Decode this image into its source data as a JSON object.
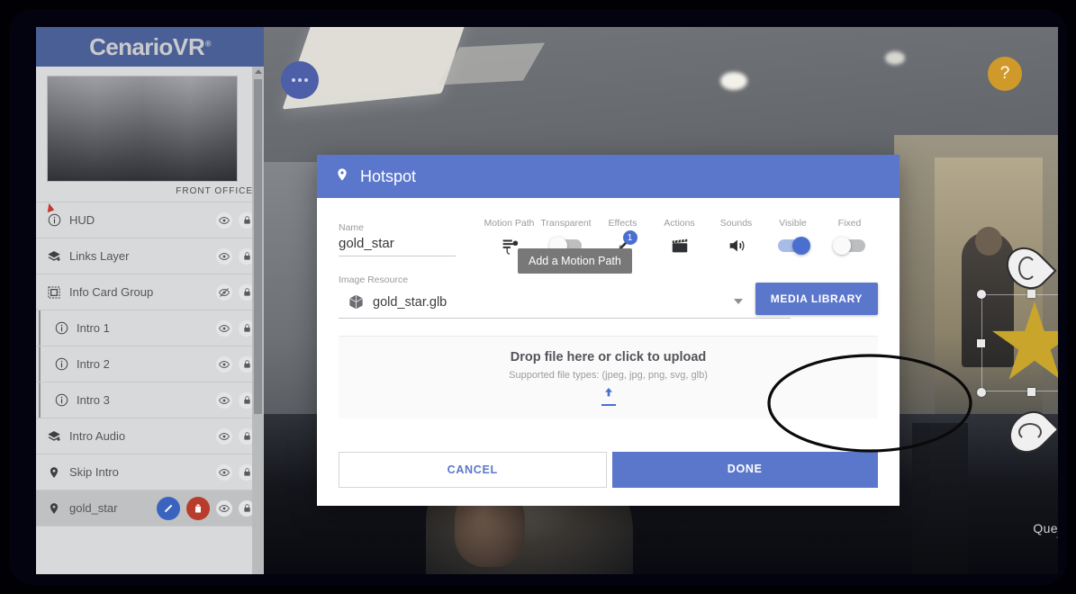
{
  "brand": {
    "name": "Cenario",
    "suffix": "VR",
    "trademark": "®"
  },
  "sidebar": {
    "thumbnail_label": "FRONT OFFICE",
    "items": [
      {
        "label": "HUD",
        "icon": "info-circle-icon",
        "visible": true,
        "locked": true,
        "child": false,
        "selected": false
      },
      {
        "label": "Links Layer",
        "icon": "layers-plus-icon",
        "visible": true,
        "locked": true,
        "child": false,
        "selected": false
      },
      {
        "label": "Info Card Group",
        "icon": "group-icon",
        "visible": false,
        "locked": true,
        "child": false,
        "selected": false
      },
      {
        "label": "Intro 1",
        "icon": "info-circle-icon",
        "visible": true,
        "locked": true,
        "child": true,
        "selected": false
      },
      {
        "label": "Intro 2",
        "icon": "info-circle-icon",
        "visible": true,
        "locked": true,
        "child": true,
        "selected": false
      },
      {
        "label": "Intro 3",
        "icon": "info-circle-icon",
        "visible": true,
        "locked": true,
        "child": true,
        "selected": false
      },
      {
        "label": "Intro Audio",
        "icon": "layers-plus-icon",
        "visible": true,
        "locked": true,
        "child": false,
        "selected": false
      },
      {
        "label": "Skip Intro",
        "icon": "map-pin-icon",
        "visible": true,
        "locked": true,
        "child": false,
        "selected": false
      },
      {
        "label": "gold_star",
        "icon": "map-pin-icon",
        "visible": true,
        "locked": true,
        "child": false,
        "selected": true
      }
    ]
  },
  "toolbar": {
    "dots_label": "•••",
    "help_label": "?"
  },
  "modal": {
    "title": "Hotspot",
    "title_icon": "map-pin-icon",
    "name_label": "Name",
    "name_value": "gold_star",
    "controls": [
      {
        "label": "Motion Path",
        "type": "icon",
        "icon": "motion-path-icon",
        "state": "hover"
      },
      {
        "label": "Transparent",
        "type": "toggle",
        "state": "off"
      },
      {
        "label": "Effects",
        "type": "icon",
        "icon": "magic-wand-icon",
        "badge": "1"
      },
      {
        "label": "Actions",
        "type": "icon",
        "icon": "clapperboard-icon"
      },
      {
        "label": "Sounds",
        "type": "icon",
        "icon": "speaker-icon"
      },
      {
        "label": "Visible",
        "type": "toggle",
        "state": "on"
      },
      {
        "label": "Fixed",
        "type": "toggle",
        "state": "off"
      }
    ],
    "tooltip": "Add a Motion Path",
    "resource_label": "Image Resource",
    "resource_icon": "cube-icon",
    "resource_value": "gold_star.glb",
    "media_library_label": "MEDIA LIBRARY",
    "dropzone_title": "Drop file here or click to upload",
    "dropzone_subtitle": "Supported file types: (jpeg, jpg, png, svg, glb)",
    "dropzone_icon": "upload-icon",
    "cancel_label": "CANCEL",
    "done_label": "DONE"
  },
  "scene": {
    "edge_text": "Que",
    "star_object": "gold-star-3d-model",
    "markers": [
      "rotate-hotspot-marker-top",
      "rotate-hotspot-marker-bottom"
    ]
  },
  "colors": {
    "brand_blue": "#4a5f96",
    "modal_blue": "#5b77cc",
    "accent_blue": "#4a6fd0",
    "help_amber": "#d09a2a",
    "delete_red": "#b83b2c",
    "edit_blue": "#3a63c0",
    "star_gold": "#c9a52c"
  }
}
